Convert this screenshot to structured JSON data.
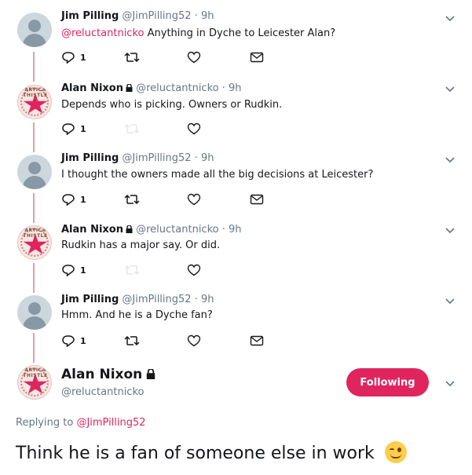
{
  "tweets": [
    {
      "avatar": "default-egg-avatar",
      "name": "Jim Pilling",
      "handle": "@JimPilling52",
      "time": "9h",
      "mention": "@reluctantnicko",
      "text": "Anything in Dyche to Leicester Alan?",
      "reply_count": "1",
      "has_dm": true,
      "protected": false
    },
    {
      "avatar": "logo-avatar",
      "name": "Alan Nixon",
      "handle": "@reluctantnicko",
      "time": "9h",
      "mention": "",
      "text": "Depends who is picking. Owners or Rudkin.",
      "reply_count": "1",
      "has_dm": false,
      "protected": true
    },
    {
      "avatar": "default-egg-avatar",
      "name": "Jim Pilling",
      "handle": "@JimPilling52",
      "time": "9h",
      "mention": "",
      "text": "I thought the owners made all the big decisions at Leicester?",
      "reply_count": "1",
      "has_dm": true,
      "protected": false
    },
    {
      "avatar": "logo-avatar",
      "name": "Alan Nixon",
      "handle": "@reluctantnicko",
      "time": "9h",
      "mention": "",
      "text": "Rudkin has a major say. Or did.",
      "reply_count": "1",
      "has_dm": false,
      "protected": true
    },
    {
      "avatar": "default-egg-avatar",
      "name": "Jim Pilling",
      "handle": "@JimPilling52",
      "time": "9h",
      "mention": "",
      "text": "Hmm. And he is a Dyche fan?",
      "reply_count": "1",
      "has_dm": true,
      "protected": false
    }
  ],
  "main_tweet": {
    "name": "Alan Nixon",
    "handle": "@reluctantnicko",
    "follow_label": "Following",
    "replying_prefix": "Replying to",
    "replying_to": "@JimPilling52",
    "text": "Think he is a fan of someone else in work",
    "emoji": "winking-face"
  },
  "colors": {
    "accent": "#e0245e",
    "thread_line": "#e3a0a8",
    "muted": "#657786",
    "text": "#14171a"
  }
}
